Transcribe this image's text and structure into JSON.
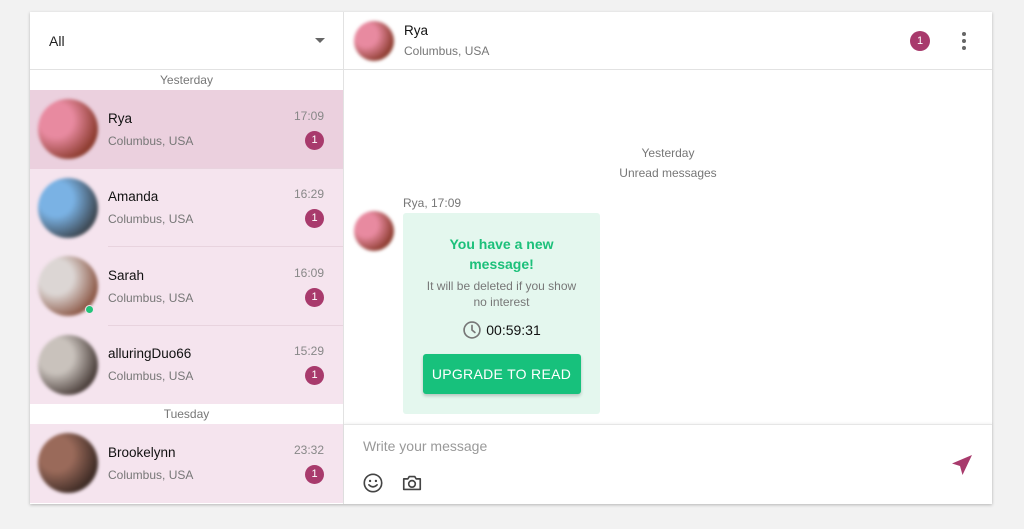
{
  "sidebar": {
    "filter": {
      "selected": "All"
    },
    "sections": [
      {
        "label": "Yesterday",
        "conversations": [
          {
            "name": "Rya",
            "location": "Columbus, USA",
            "time": "17:09",
            "unread": "1",
            "active": true,
            "online": false,
            "avatar_colors": [
              "#e88aa0",
              "#8a3a2c"
            ]
          },
          {
            "name": "Amanda",
            "location": "Columbus, USA",
            "time": "16:29",
            "unread": "1",
            "active": false,
            "online": false,
            "avatar_colors": [
              "#7ab2e4",
              "#3c4650"
            ]
          },
          {
            "name": "Sarah",
            "location": "Columbus, USA",
            "time": "16:09",
            "unread": "1",
            "active": false,
            "online": true,
            "avatar_colors": [
              "#dcd6d4",
              "#8c5846"
            ]
          },
          {
            "name": "alluringDuo66",
            "location": "Columbus, USA",
            "time": "15:29",
            "unread": "1",
            "active": false,
            "online": false,
            "avatar_colors": [
              "#c9c2bc",
              "#4a3e3a"
            ]
          }
        ]
      },
      {
        "label": "Tuesday",
        "conversations": [
          {
            "name": "Brookelynn",
            "location": "Columbus, USA",
            "time": "23:32",
            "unread": "1",
            "active": false,
            "online": false,
            "avatar_colors": [
              "#9a6a5a",
              "#3c2a24"
            ]
          }
        ]
      }
    ]
  },
  "chat": {
    "header": {
      "name": "Rya",
      "location": "Columbus, USA",
      "unread": "1",
      "avatar_colors": [
        "#e88aa0",
        "#8a3a2c"
      ]
    },
    "day_label": "Yesterday",
    "unread_label": "Unread messages",
    "message": {
      "meta": "Rya, 17:09",
      "title": "You have a new message!",
      "subtitle": "It will be deleted if you show no interest",
      "timer": "00:59:31",
      "button_label": "UPGRADE TO READ"
    },
    "composer": {
      "placeholder": "Write your message",
      "value": ""
    }
  },
  "colors": {
    "accent": "#a83a6c",
    "green": "#17c17c",
    "list_bg": "#f5e4ee",
    "active_bg": "#ebd0de",
    "bubble_bg": "#e4f7ee"
  }
}
